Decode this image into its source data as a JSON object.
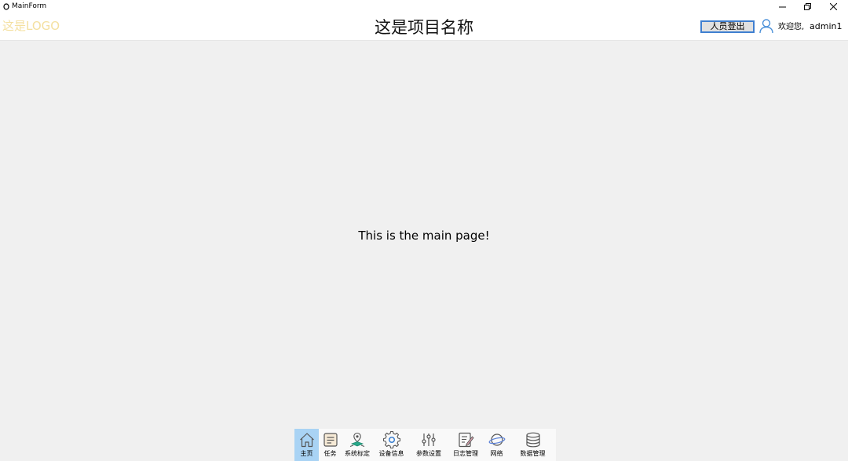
{
  "window": {
    "title": "MainForm"
  },
  "header": {
    "logo": "这是LOGO",
    "project_name": "这是项目名称",
    "logout_label": "人员登出",
    "welcome": "欢迎您,",
    "username": "admin1"
  },
  "main": {
    "message": "This is the main page!"
  },
  "nav": {
    "items": [
      {
        "label": "主页",
        "icon": "home-icon",
        "active": true
      },
      {
        "label": "任务",
        "icon": "task-icon",
        "active": false
      },
      {
        "label": "系统标定",
        "icon": "calibration-icon",
        "active": false
      },
      {
        "label": "设备信息",
        "icon": "settings-gear-icon",
        "active": false
      },
      {
        "label": "参数设置",
        "icon": "sliders-icon",
        "active": false
      },
      {
        "label": "日志管理",
        "icon": "log-icon",
        "active": false
      },
      {
        "label": "网络",
        "icon": "network-planet-icon",
        "active": false
      },
      {
        "label": "数据管理",
        "icon": "database-icon",
        "active": false
      }
    ]
  },
  "colors": {
    "logo": "#f4e0a0",
    "active_tab": "#a9d3f4",
    "logout_border": "#3f7fd0",
    "content_bg": "#f0f0f0"
  }
}
